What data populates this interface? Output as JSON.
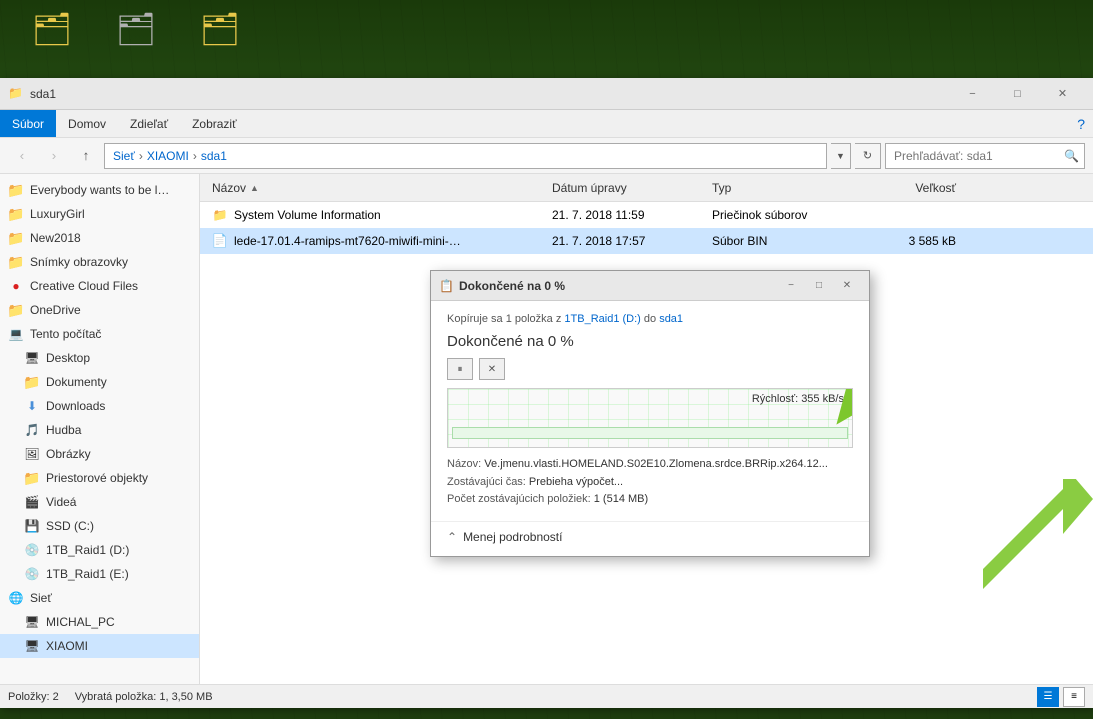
{
  "desktop": {
    "icons": [
      {
        "name": "folder1",
        "label": "",
        "type": "folder-yellow"
      },
      {
        "name": "folder2",
        "label": "",
        "type": "folder-gray"
      },
      {
        "name": "folder3",
        "label": "",
        "type": "folder-yellow2"
      }
    ]
  },
  "window": {
    "title": "sda1",
    "titlebar_icon": "📁"
  },
  "menu": {
    "items": [
      "Súbor",
      "Domov",
      "Zdieľať",
      "Zobraziť"
    ]
  },
  "toolbar": {
    "back_tooltip": "Späť",
    "forward_tooltip": "Vpred",
    "up_tooltip": "Nahor",
    "address": "Sieť › XIAOMI › sda1",
    "address_parts": [
      "Sieť",
      "XIAOMI",
      "sda1"
    ],
    "search_placeholder": "Prehľadávať: sda1",
    "refresh_tooltip": "Obnoviť"
  },
  "sidebar": {
    "quick_access_label": "",
    "items": [
      {
        "id": "everybody",
        "label": "Everybody wants to be l…",
        "type": "folder",
        "indent": 0
      },
      {
        "id": "luxurygirl",
        "label": "LuxuryGirl",
        "type": "folder",
        "indent": 0
      },
      {
        "id": "new2018",
        "label": "New2018",
        "type": "folder",
        "indent": 0
      },
      {
        "id": "snimky",
        "label": "Snímky obrazovky",
        "type": "folder",
        "indent": 0
      },
      {
        "id": "cc-files",
        "label": "Creative Cloud Files",
        "type": "cc",
        "indent": 0
      },
      {
        "id": "onedrive",
        "label": "OneDrive",
        "type": "folder-blue",
        "indent": 0
      },
      {
        "id": "tento-pc",
        "label": "Tento počítač",
        "type": "pc",
        "indent": 0
      },
      {
        "id": "desktop",
        "label": "Desktop",
        "type": "desktop",
        "indent": 1
      },
      {
        "id": "dokumenty",
        "label": "Dokumenty",
        "type": "folder",
        "indent": 1
      },
      {
        "id": "downloads",
        "label": "Downloads",
        "type": "downloads",
        "indent": 1
      },
      {
        "id": "hudba",
        "label": "Hudba",
        "type": "folder",
        "indent": 1
      },
      {
        "id": "obrazky",
        "label": "Obrázky",
        "type": "folder",
        "indent": 1
      },
      {
        "id": "priestorove",
        "label": "Priestorové objekty",
        "type": "folder",
        "indent": 1
      },
      {
        "id": "videa",
        "label": "Videá",
        "type": "folder",
        "indent": 1
      },
      {
        "id": "ssd-c",
        "label": "SSD (C:)",
        "type": "drive",
        "indent": 1
      },
      {
        "id": "raid1-d",
        "label": "1TB_Raid1 (D:)",
        "type": "drive",
        "indent": 1
      },
      {
        "id": "raid1-e",
        "label": "1TB_Raid1 (E:)",
        "type": "drive",
        "indent": 1
      },
      {
        "id": "siet",
        "label": "Sieť",
        "type": "network",
        "indent": 0
      },
      {
        "id": "michal-pc",
        "label": "MICHAL_PC",
        "type": "pc",
        "indent": 1
      },
      {
        "id": "xiaomi",
        "label": "XIAOMI",
        "type": "pc",
        "indent": 1,
        "selected": true
      }
    ]
  },
  "file_list": {
    "columns": {
      "name": "Názov",
      "date": "Dátum úpravy",
      "type": "Typ",
      "size": "Veľkosť"
    },
    "files": [
      {
        "name": "System Volume Information",
        "date": "21. 7. 2018 11:59",
        "type": "Priečinok súborov",
        "size": "",
        "icon": "folder"
      },
      {
        "name": "lede-17.01.4-ramips-mt7620-miwifi-mini-…",
        "date": "21. 7. 2018 17:57",
        "type": "Súbor BIN",
        "size": "3 585 kB",
        "icon": "file",
        "selected": true
      }
    ]
  },
  "status_bar": {
    "items_count": "Položky: 2",
    "selected_info": "Vybratá položka: 1, 3,50 MB"
  },
  "progress_dialog": {
    "title": "Dokončené na 0 %",
    "subtitle_prefix": "Kopíruje sa 1 položka z ",
    "source_link": "1TB_Raid1 (D:)",
    "subtitle_middle": " do ",
    "dest_link": "sda1",
    "main_label": "Dokončené na 0 %",
    "speed_label": "Rýchlosť: 355 kB/s",
    "progress_percent": 0,
    "info": {
      "name_label": "Názov: ",
      "name_value": "Ve.jmenu.vlasti.HOMELAND.S02E10.Zlomena.srdce.BRRip.x264.12...",
      "remaining_time_label": "Zostávajúci čas: ",
      "remaining_time_value": "Prebieha výpočet...",
      "remaining_items_label": "Počet zostávajúcich položiek: ",
      "remaining_items_value": "1 (514 MB)"
    },
    "footer": {
      "details_label": "Menej podrobností"
    },
    "controls": {
      "pause_label": "⏸",
      "stop_label": "✕"
    }
  }
}
